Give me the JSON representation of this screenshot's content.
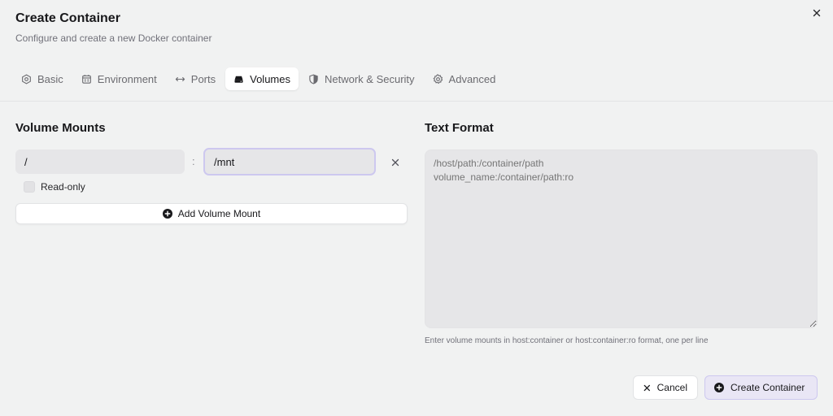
{
  "dialog": {
    "title": "Create Container",
    "subtitle": "Configure and create a new Docker container",
    "close_icon": "close-icon"
  },
  "tabs": [
    {
      "label": "Basic",
      "icon": "cube-icon",
      "active": false
    },
    {
      "label": "Environment",
      "icon": "env-icon",
      "active": false
    },
    {
      "label": "Ports",
      "icon": "arrows-horizontal-icon",
      "active": false
    },
    {
      "label": "Volumes",
      "icon": "hard-drive-icon",
      "active": true
    },
    {
      "label": "Network & Security",
      "icon": "shield-icon",
      "active": false
    },
    {
      "label": "Advanced",
      "icon": "gear-icon",
      "active": false
    }
  ],
  "volume_mounts": {
    "title": "Volume Mounts",
    "mounts": [
      {
        "host": "/",
        "separator": ":",
        "container": "/mnt",
        "read_only_label": "Read-only",
        "read_only": false
      }
    ],
    "add_label": "Add Volume Mount"
  },
  "text_format": {
    "title": "Text Format",
    "placeholder": "/host/path:/container/path\nvolume_name:/container/path:ro",
    "help": "Enter volume mounts in host:container or host:container:ro format, one per line"
  },
  "footer": {
    "cancel_label": "Cancel",
    "create_label": "Create Container"
  },
  "colors": {
    "background": "#f1f2f2",
    "accent_border": "#cdc8ef",
    "accent_fill": "#e9e6f5"
  }
}
